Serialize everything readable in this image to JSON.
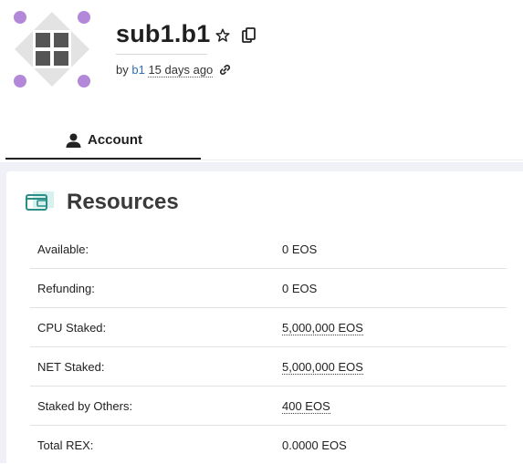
{
  "account": {
    "name": "sub1.b1",
    "by_prefix": "by",
    "creator": "b1",
    "created_ago": "15 days ago"
  },
  "tabs": [
    {
      "label": "Account",
      "icon": "user-icon",
      "active": true
    }
  ],
  "resources": {
    "title": "Resources",
    "icon": "wallet-icon",
    "rows": [
      {
        "label": "Available:",
        "value": "0 EOS"
      },
      {
        "label": "Refunding:",
        "value": "0 EOS"
      },
      {
        "label": "CPU Staked:",
        "value": "5,000,000 EOS"
      },
      {
        "label": "NET Staked:",
        "value": "5,000,000 EOS"
      },
      {
        "label": "Staked by Others:",
        "value": "400 EOS"
      },
      {
        "label": "Total REX:",
        "value": "0.0000 EOS"
      }
    ]
  },
  "colors": {
    "accent_link": "#2f6fb4",
    "avatar_diamond": "#e3e3e3",
    "avatar_dots": "#b388d9",
    "avatar_grid": "#555555",
    "wallet_icon": "#2a8f86"
  }
}
